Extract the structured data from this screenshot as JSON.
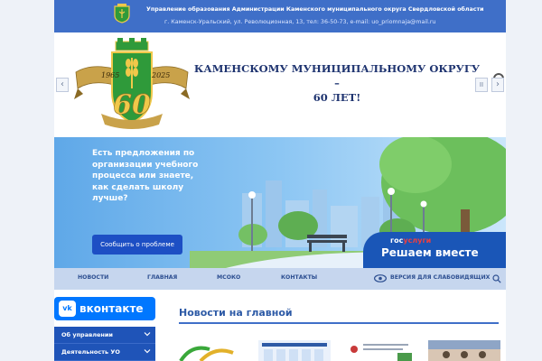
{
  "header": {
    "org_name": "Управление образования Администрации Каменского муниципального округа Свердловской области",
    "address": "г. Каменск-Уральский, ул. Революционная, 13, тел: 36-50-73, e-mail: uo_priomnaja@mail.ru"
  },
  "banner": {
    "year_start": "1965",
    "year_end": "2025",
    "anniversary": "60",
    "headline_line1": "КАМЕНСКОМУ МУНИЦИПАЛЬНОМУ ОКРУГУ –",
    "headline_line2": "60 ЛЕТ!",
    "prev_label": "‹",
    "next_label": "›",
    "pause_label": "II"
  },
  "promo": {
    "text": "Есть предложения по организации учебного процесса или знаете, как сделать школу лучше?",
    "button_label": "Сообщить о проблеме",
    "brand_gos": "гос",
    "brand_uslugi": "услуги",
    "slogan": "Решаем вместе"
  },
  "nav": {
    "items": [
      "НОВОСТИ",
      "ГЛАВНАЯ",
      "МСОКО",
      "КОНТАКТЫ"
    ],
    "accessibility": "ВЕРСИЯ ДЛЯ СЛАБОВИДЯЩИХ"
  },
  "sidebar": {
    "vk_logo": "vk",
    "vk_label": "вконтакте",
    "menu": [
      "Об управлении",
      "Деятельность УО"
    ]
  },
  "news": {
    "title": "Новости на главной"
  },
  "colors": {
    "header_blue": "#3f6fc8",
    "nav_bg": "#c6d6ee",
    "button_blue": "#1d4fc4",
    "vk_blue": "#0077ff"
  }
}
